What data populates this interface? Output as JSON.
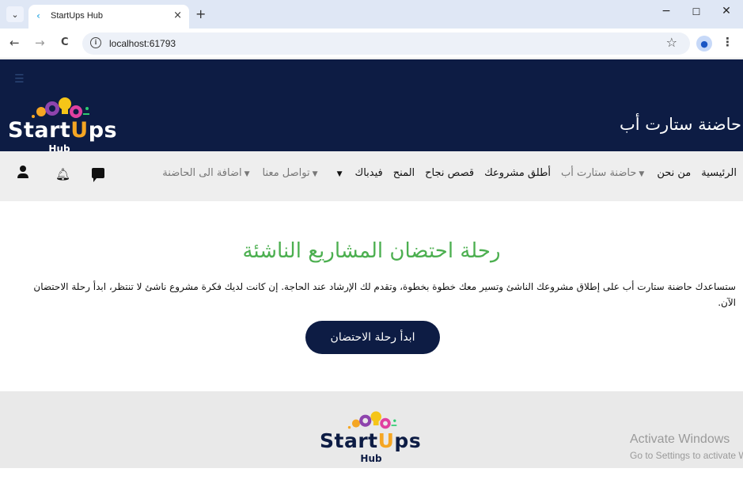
{
  "browser": {
    "tab_title": "StartUps Hub",
    "tab_close": "×",
    "new_tab": "+",
    "tab_menu_icon": "chevron-down-icon",
    "url": "localhost:61793",
    "minimize": "−",
    "maximize": "☐",
    "close": "✕",
    "back": "←",
    "forward": "→",
    "reload": "C",
    "star": "☆",
    "menu": "⋮"
  },
  "hero": {
    "title": "حاضنة ستارت أب",
    "logo": {
      "word": "StartUps",
      "sub": "Hub"
    }
  },
  "nav": {
    "items": [
      {
        "label": "الرئيسية",
        "dropdown": false,
        "muted": false
      },
      {
        "label": "من نحن",
        "dropdown": false,
        "muted": false
      },
      {
        "label": "حاضنة ستارت أب",
        "dropdown": true,
        "muted": true
      },
      {
        "label": "أطلق مشروعك",
        "dropdown": false,
        "muted": false
      },
      {
        "label": "قصص نجاح",
        "dropdown": false,
        "muted": false
      },
      {
        "label": "المنح",
        "dropdown": false,
        "muted": false
      },
      {
        "label": "فيدباك",
        "dropdown": false,
        "muted": false
      },
      {
        "label": "",
        "dropdown": true,
        "muted": false
      },
      {
        "label": "تواصل معنا",
        "dropdown": true,
        "muted": true
      },
      {
        "label": "اضافة الى الحاضنة",
        "dropdown": true,
        "muted": true
      }
    ]
  },
  "main": {
    "title": "رحلة احتضان المشاريع الناشئة",
    "description": "ستساعدك حاضنة ستارت أب على إطلاق مشروعك الناشئ وتسير معك خطوة بخطوة، وتقدم لك الإرشاد عند الحاجة. إن كانت لديك فكرة مشروع ناشئ لا تنتظر، ابدأ رحلة الاحتضان الآن.",
    "cta_label": "ابدأ رحلة الاحتضان"
  },
  "footer": {
    "logo": {
      "word": "StartUps",
      "sub": "Hub"
    }
  },
  "watermark": {
    "title": "Activate Windows",
    "subtitle": "Go to Settings to activate Windows."
  },
  "colors": {
    "navy": "#0d1c44",
    "green": "#4caf50",
    "logo_start": "#ffffff",
    "logo_u": "#f5a623",
    "logo_ps": "#e040a0"
  }
}
